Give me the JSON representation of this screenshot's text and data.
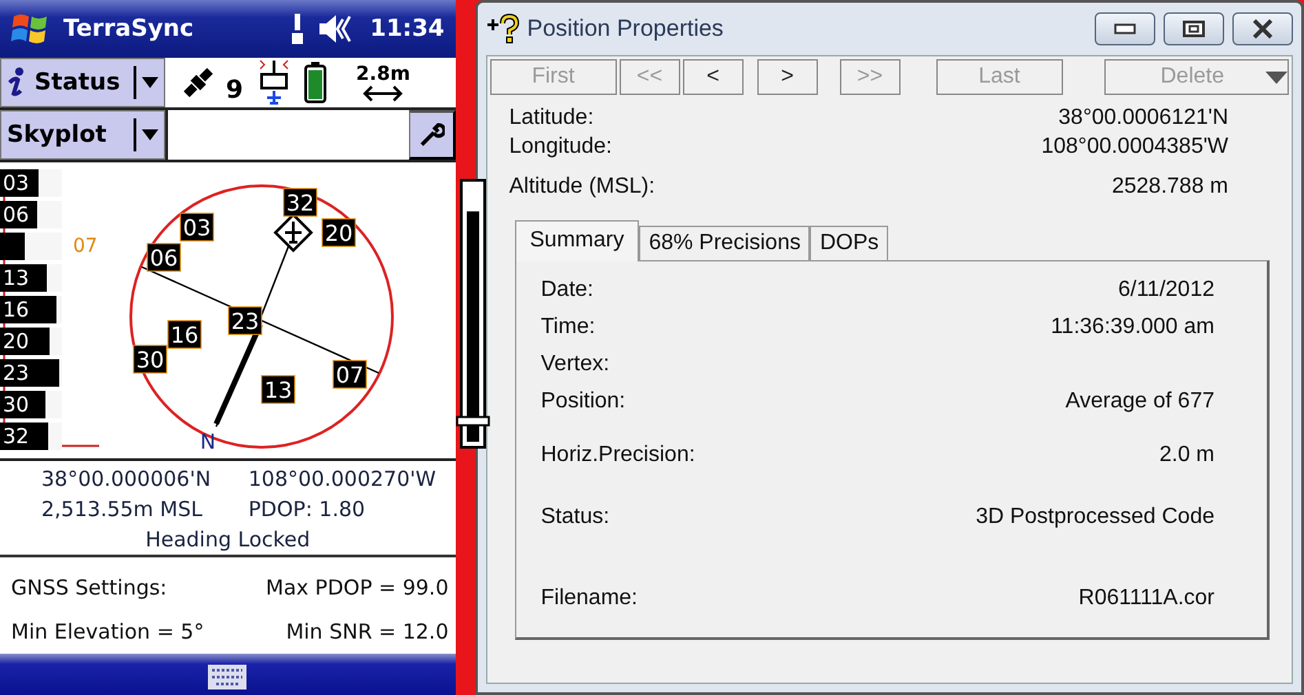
{
  "device": {
    "title": "TerraSync",
    "time": "11:34",
    "status_dropdown": {
      "label": "Status"
    },
    "satellite_count": "9",
    "accuracy": "2.8m",
    "view_dropdown": {
      "label": "Skyplot"
    },
    "snr_bars": [
      {
        "label": "03",
        "level": 0.62
      },
      {
        "label": "06",
        "level": 0.6
      },
      {
        "label": "07",
        "level": 0.4
      },
      {
        "label": "13",
        "level": 0.76
      },
      {
        "label": "16",
        "level": 0.9
      },
      {
        "label": "20",
        "level": 0.8
      },
      {
        "label": "23",
        "level": 0.95
      },
      {
        "label": "30",
        "level": 0.73
      },
      {
        "label": "32",
        "level": 0.78
      }
    ],
    "skyplot_satellites": [
      "32",
      "20",
      "03",
      "06",
      "23",
      "16",
      "30",
      "07",
      "13"
    ],
    "north_label": "N",
    "elevation_mask": {
      "level": 0.9
    },
    "position": {
      "latitude": "38°00.000006'N",
      "longitude": "108°00.000270'W",
      "altitude": "2,513.55m MSL",
      "pdop": "PDOP: 1.80",
      "heading": "Heading Locked"
    },
    "settings": {
      "title": "GNSS Settings:",
      "max_pdop": "Max PDOP = 99.0",
      "min_elevation": "Min Elevation = 5°",
      "min_snr": "Min SNR = 12.0"
    }
  },
  "window": {
    "title": "Position Properties",
    "nav_buttons": [
      {
        "label": "First",
        "disabled": true
      },
      {
        "label": "<<",
        "disabled": true
      },
      {
        "label": "<",
        "disabled": false
      },
      {
        "label": ">",
        "disabled": false
      },
      {
        "label": ">>",
        "disabled": true
      },
      {
        "label": "Last",
        "disabled": true
      }
    ],
    "delete_button": {
      "label": "Delete",
      "disabled": true
    },
    "fields": [
      {
        "label": "Latitude:",
        "value": "38°00.0006121'N"
      },
      {
        "label": "Longitude:",
        "value": "108°00.0004385'W"
      },
      {
        "label": "Altitude (MSL):",
        "value": "2528.788 m"
      }
    ],
    "tabs": [
      {
        "label": "Summary",
        "selected": true
      },
      {
        "label": "68% Precisions",
        "selected": false
      },
      {
        "label": "DOPs",
        "selected": false
      }
    ],
    "summary": [
      {
        "label": "Date:",
        "value": "6/11/2012"
      },
      {
        "label": "Time:",
        "value": "11:36:39.000 am"
      },
      {
        "label": "Vertex:"
      },
      {
        "label": "Position:",
        "value": "Average of 677"
      },
      {
        "label": "Horiz.Precision:",
        "value": "2.0 m"
      },
      {
        "label": "Status:",
        "value": "3D Postprocessed Code"
      },
      {
        "label": "Filename:",
        "value": "R061111A.cor"
      }
    ]
  }
}
